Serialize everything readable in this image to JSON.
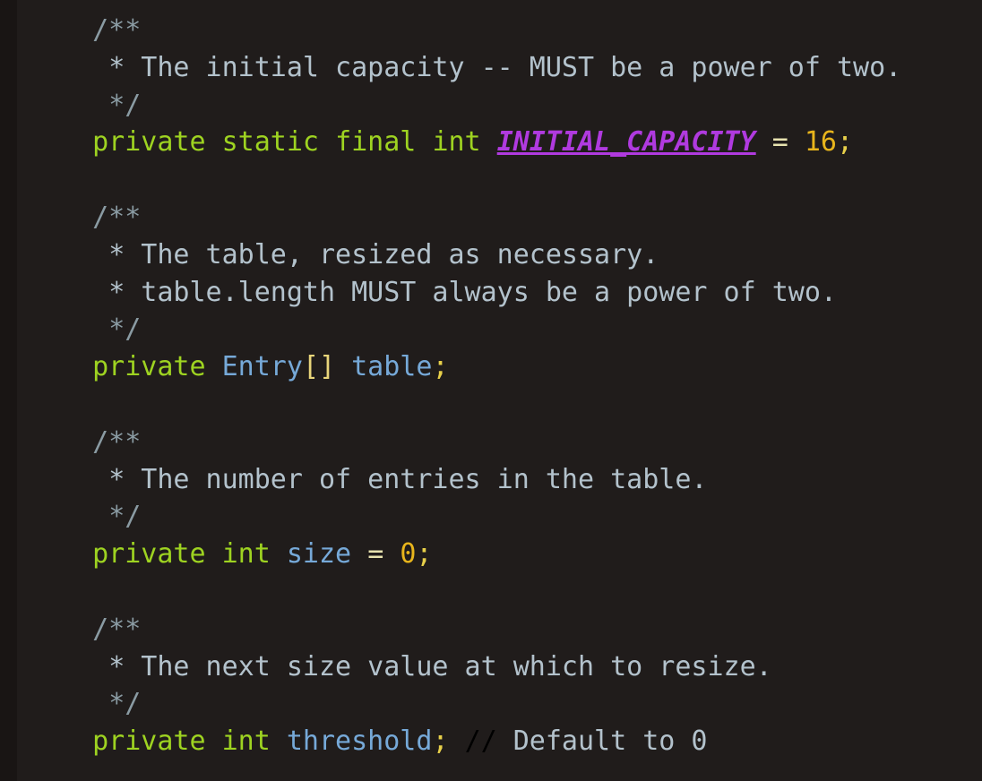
{
  "editor": {
    "language": "java",
    "background_color": "#201c1b",
    "gutter_color": "#191514",
    "font_size_px": 30,
    "line_height_px": 41.8
  },
  "theme": {
    "comment": "#b3c2cc",
    "comment_delimiter": "#8a9ba3",
    "line_comment_slashes": "#9aa89a",
    "keyword": "#9ed321",
    "type": "#76a9d8",
    "identifier": "#76a9d8",
    "constant": "#b03adf",
    "number": "#e8b51c",
    "punctuation": "#e8d57a",
    "operator": "#e8e3b0",
    "semicolon": "#e8d04a"
  },
  "code": {
    "lines": [
      {
        "id": "line-1",
        "kind": "comment-open",
        "tokens": [
          {
            "t": "  ",
            "c": "tok-plain"
          },
          {
            "t": "/**",
            "c": "tok-comment-d"
          }
        ]
      },
      {
        "id": "line-2",
        "kind": "comment-body",
        "tokens": [
          {
            "t": "   ",
            "c": "tok-plain"
          },
          {
            "t": "* The initial capacity -- MUST be a power of two.",
            "c": "tok-comment"
          }
        ]
      },
      {
        "id": "line-3",
        "kind": "comment-close",
        "tokens": [
          {
            "t": "   ",
            "c": "tok-plain"
          },
          {
            "t": "*/",
            "c": "tok-comment-d"
          }
        ]
      },
      {
        "id": "line-4",
        "kind": "declaration",
        "tokens": [
          {
            "t": "  ",
            "c": "tok-plain"
          },
          {
            "t": "private",
            "c": "tok-kw"
          },
          {
            "t": " ",
            "c": "tok-plain"
          },
          {
            "t": "static",
            "c": "tok-kw"
          },
          {
            "t": " ",
            "c": "tok-plain"
          },
          {
            "t": "final",
            "c": "tok-kw"
          },
          {
            "t": " ",
            "c": "tok-plain"
          },
          {
            "t": "int",
            "c": "tok-kw"
          },
          {
            "t": " ",
            "c": "tok-plain"
          },
          {
            "t": "INITIAL_CAPACITY",
            "c": "tok-const"
          },
          {
            "t": " ",
            "c": "tok-plain"
          },
          {
            "t": "=",
            "c": "tok-op"
          },
          {
            "t": " ",
            "c": "tok-plain"
          },
          {
            "t": "16",
            "c": "tok-num"
          },
          {
            "t": ";",
            "c": "tok-semi"
          }
        ]
      },
      {
        "id": "line-5",
        "kind": "blank",
        "tokens": []
      },
      {
        "id": "line-6",
        "kind": "comment-open",
        "tokens": [
          {
            "t": "  ",
            "c": "tok-plain"
          },
          {
            "t": "/**",
            "c": "tok-comment-d"
          }
        ]
      },
      {
        "id": "line-7",
        "kind": "comment-body",
        "tokens": [
          {
            "t": "   ",
            "c": "tok-plain"
          },
          {
            "t": "* The table, resized as necessary.",
            "c": "tok-comment"
          }
        ]
      },
      {
        "id": "line-8",
        "kind": "comment-body",
        "tokens": [
          {
            "t": "   ",
            "c": "tok-plain"
          },
          {
            "t": "* table.length MUST always be a power of two.",
            "c": "tok-comment"
          }
        ]
      },
      {
        "id": "line-9",
        "kind": "comment-close",
        "tokens": [
          {
            "t": "   ",
            "c": "tok-plain"
          },
          {
            "t": "*/",
            "c": "tok-comment-d"
          }
        ]
      },
      {
        "id": "line-10",
        "kind": "declaration",
        "tokens": [
          {
            "t": "  ",
            "c": "tok-plain"
          },
          {
            "t": "private",
            "c": "tok-kw"
          },
          {
            "t": " ",
            "c": "tok-plain"
          },
          {
            "t": "Entry",
            "c": "tok-type"
          },
          {
            "t": "[]",
            "c": "tok-punc"
          },
          {
            "t": " ",
            "c": "tok-plain"
          },
          {
            "t": "table",
            "c": "tok-ident"
          },
          {
            "t": ";",
            "c": "tok-semi"
          }
        ]
      },
      {
        "id": "line-11",
        "kind": "blank",
        "tokens": []
      },
      {
        "id": "line-12",
        "kind": "comment-open",
        "tokens": [
          {
            "t": "  ",
            "c": "tok-plain"
          },
          {
            "t": "/**",
            "c": "tok-comment-d"
          }
        ]
      },
      {
        "id": "line-13",
        "kind": "comment-body",
        "tokens": [
          {
            "t": "   ",
            "c": "tok-plain"
          },
          {
            "t": "* The number of entries in the table.",
            "c": "tok-comment"
          }
        ]
      },
      {
        "id": "line-14",
        "kind": "comment-close",
        "tokens": [
          {
            "t": "   ",
            "c": "tok-plain"
          },
          {
            "t": "*/",
            "c": "tok-comment-d"
          }
        ]
      },
      {
        "id": "line-15",
        "kind": "declaration",
        "tokens": [
          {
            "t": "  ",
            "c": "tok-plain"
          },
          {
            "t": "private",
            "c": "tok-kw"
          },
          {
            "t": " ",
            "c": "tok-plain"
          },
          {
            "t": "int",
            "c": "tok-kw"
          },
          {
            "t": " ",
            "c": "tok-plain"
          },
          {
            "t": "size",
            "c": "tok-ident"
          },
          {
            "t": " ",
            "c": "tok-plain"
          },
          {
            "t": "=",
            "c": "tok-op"
          },
          {
            "t": " ",
            "c": "tok-plain"
          },
          {
            "t": "0",
            "c": "tok-num"
          },
          {
            "t": ";",
            "c": "tok-semi"
          }
        ]
      },
      {
        "id": "line-16",
        "kind": "blank",
        "tokens": []
      },
      {
        "id": "line-17",
        "kind": "comment-open",
        "tokens": [
          {
            "t": "  ",
            "c": "tok-plain"
          },
          {
            "t": "/**",
            "c": "tok-comment-d"
          }
        ]
      },
      {
        "id": "line-18",
        "kind": "comment-body",
        "tokens": [
          {
            "t": "   ",
            "c": "tok-plain"
          },
          {
            "t": "* The next size value at which to resize.",
            "c": "tok-comment"
          }
        ]
      },
      {
        "id": "line-19",
        "kind": "comment-close",
        "tokens": [
          {
            "t": "   ",
            "c": "tok-plain"
          },
          {
            "t": "*/",
            "c": "tok-comment-d"
          }
        ]
      },
      {
        "id": "line-20",
        "kind": "declaration",
        "tokens": [
          {
            "t": "  ",
            "c": "tok-plain"
          },
          {
            "t": "private",
            "c": "tok-kw"
          },
          {
            "t": " ",
            "c": "tok-plain"
          },
          {
            "t": "int",
            "c": "tok-kw"
          },
          {
            "t": " ",
            "c": "tok-plain"
          },
          {
            "t": "threshold",
            "c": "tok-ident"
          },
          {
            "t": ";",
            "c": "tok-semi"
          },
          {
            "t": " ",
            "c": "tok-plain"
          },
          {
            "t": "//",
            "c": "tok-linecom"
          },
          {
            "t": " Default to 0",
            "c": "tok-linecom-t"
          }
        ]
      }
    ]
  }
}
